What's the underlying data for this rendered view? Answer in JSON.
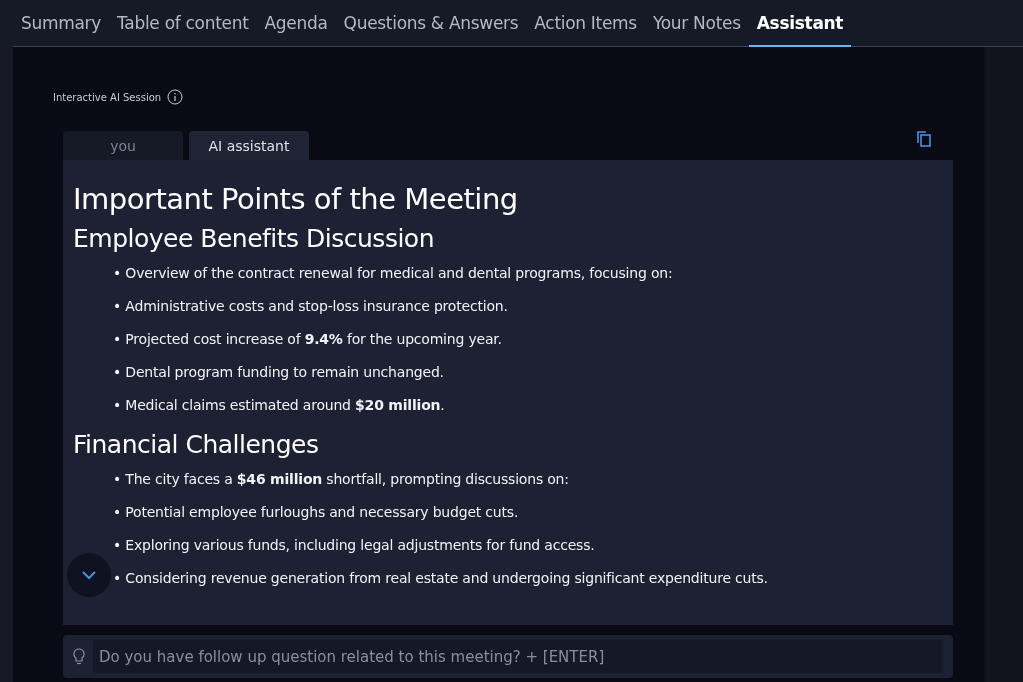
{
  "tabs": [
    {
      "label": "Summary",
      "selected": false
    },
    {
      "label": "Table of content",
      "selected": false
    },
    {
      "label": "Agenda",
      "selected": false
    },
    {
      "label": "Questions & Answers",
      "selected": false
    },
    {
      "label": "Action Items",
      "selected": false
    },
    {
      "label": "Your Notes",
      "selected": false
    },
    {
      "label": "Assistant",
      "selected": true
    }
  ],
  "session_label": "Interactive AI Session",
  "speaker_tabs": [
    {
      "label": "you",
      "selected": false
    },
    {
      "label": "AI assistant",
      "selected": true
    }
  ],
  "answer": {
    "title": "Important Points of the Meeting",
    "sections": [
      {
        "heading": "Employee Benefits Discussion",
        "items": [
          "• Overview of the contract renewal for medical and dental programs, focusing on:",
          "• Administrative costs and stop-loss insurance protection.",
          "• Projected cost increase of **9.4%** for the upcoming year.",
          "• Dental program funding to remain unchanged.",
          "• Medical claims estimated around **$20 million**."
        ]
      },
      {
        "heading": "Financial Challenges",
        "items": [
          "• The city faces a **$46 million** shortfall, prompting discussions on:",
          "• Potential employee furloughs and necessary budget cuts.",
          "• Exploring various funds, including legal adjustments for fund access.",
          "• Considering revenue generation from real estate and undergoing significant expenditure cuts."
        ]
      }
    ]
  },
  "question_field": {
    "placeholder": "Do you have follow up question related to this meeting? + [ENTER]"
  }
}
